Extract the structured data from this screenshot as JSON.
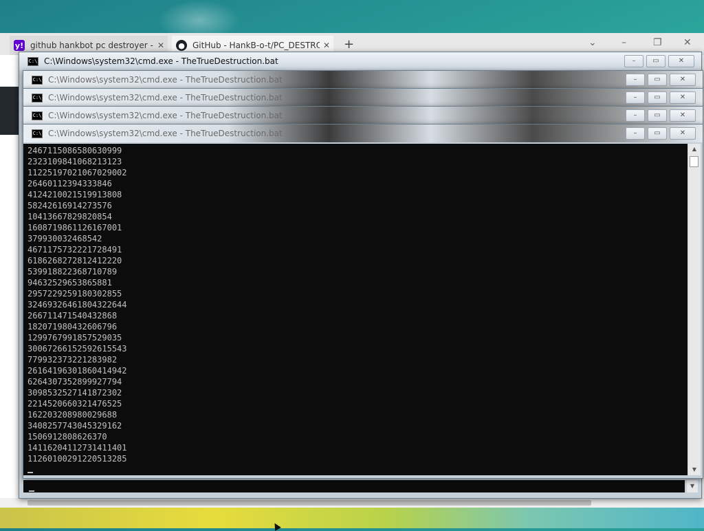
{
  "browser": {
    "tabs": [
      {
        "label": "github hankbot pc destroyer - Y",
        "icon": "yahoo-icon"
      },
      {
        "label": "GitHub - HankB-o-t/PC_DESTRO",
        "icon": "github-icon"
      }
    ],
    "new_tab": "+",
    "close_glyph": "✕"
  },
  "windows": {
    "main_title": "C:\\Windows\\system32\\cmd.exe - TheTrueDestruction.bat",
    "ghost_titles": [
      "C:\\Windows\\system32\\cmd.exe - TheTrueDestruction.bat",
      "C:\\Windows\\system32\\cmd.exe - TheTrueDestruction.bat",
      "C:\\Windows\\system32\\cmd.exe - TheTrueDestruction.bat",
      "C:\\Windows\\system32\\cmd.exe - TheTrueDestruction.bat"
    ]
  },
  "console": {
    "lines": [
      "2467115086580630999",
      "2323109841068213123",
      "11225197021067029002",
      "26460112394333846",
      "4124210021519913808",
      "58242616914273576",
      "10413667829820854",
      "1608719861126167001",
      "379930032468542",
      "4671175732221728491",
      "6186268272812412220",
      "539918822368710789",
      "94632529653865881",
      "2957229259180302855",
      "32469326461804322644",
      "266711471540432868",
      "182071980432606796",
      "1299767991857529035",
      "30067266152592615543",
      "779932373221283982",
      "26164196301860414942",
      "6264307352899927794",
      "3098532527141872302",
      "2214520660321476525",
      "162203208980029688",
      "3408257743045329162",
      "1506912808626370",
      "14116204112731411401",
      "11260100291220513285"
    ]
  }
}
